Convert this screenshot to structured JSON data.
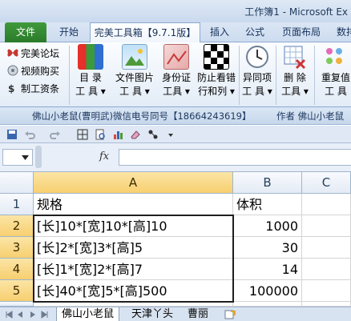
{
  "window": {
    "title": "工作簿1 - Microsoft Ex"
  },
  "tabs": [
    {
      "label": "文件"
    },
    {
      "label": "开始"
    },
    {
      "label": "完美工具箱【9.7.1版】"
    },
    {
      "label": "插入"
    },
    {
      "label": "公式"
    },
    {
      "label": "页面布局"
    },
    {
      "label": "数排"
    }
  ],
  "ribbon": {
    "left_commands": [
      {
        "label": "完美论坛"
      },
      {
        "label": "视频购买"
      },
      {
        "label": "制工资条"
      }
    ],
    "buttons": [
      {
        "line1": "目 录",
        "line2": "工 具 ▾"
      },
      {
        "line1": "文件图片",
        "line2": "工 具 ▾"
      },
      {
        "line1": "身份证",
        "line2": "工具 ▾"
      },
      {
        "line1": "防止看错",
        "line2": "行和列 ▾"
      },
      {
        "line1": "异同项",
        "line2": "工 具 ▾"
      },
      {
        "line1": "删 除",
        "line2": "工具 ▾"
      },
      {
        "line1": "重复值",
        "line2": "工 具"
      }
    ]
  },
  "caption": {
    "text": "佛山小老鼠(曹明武)微信电号同号【18664243619】",
    "author": "作者 佛山小老鼠"
  },
  "formula_bar": {
    "fx_label": "fx",
    "value": ""
  },
  "sheet": {
    "columns": [
      "A",
      "B",
      "C"
    ],
    "rows": [
      {
        "num": "1",
        "a": "规格",
        "b": "体积",
        "c": ""
      },
      {
        "num": "2",
        "a": "[长]10*[宽]10*[高]10",
        "b": "1000",
        "c": ""
      },
      {
        "num": "3",
        "a": "[长]2*[宽]3*[高]5",
        "b": "30",
        "c": ""
      },
      {
        "num": "4",
        "a": "[长]1*[宽]2*[高]7",
        "b": "14",
        "c": ""
      },
      {
        "num": "5",
        "a": "[长]40*[宽]5*[高]500",
        "b": "100000",
        "c": ""
      },
      {
        "num": "6",
        "a": "",
        "b": "",
        "c": ""
      }
    ],
    "sheet_tabs": [
      {
        "label": "佛山小老鼠"
      },
      {
        "label": "天津丫头"
      },
      {
        "label": "曹丽"
      }
    ]
  }
}
